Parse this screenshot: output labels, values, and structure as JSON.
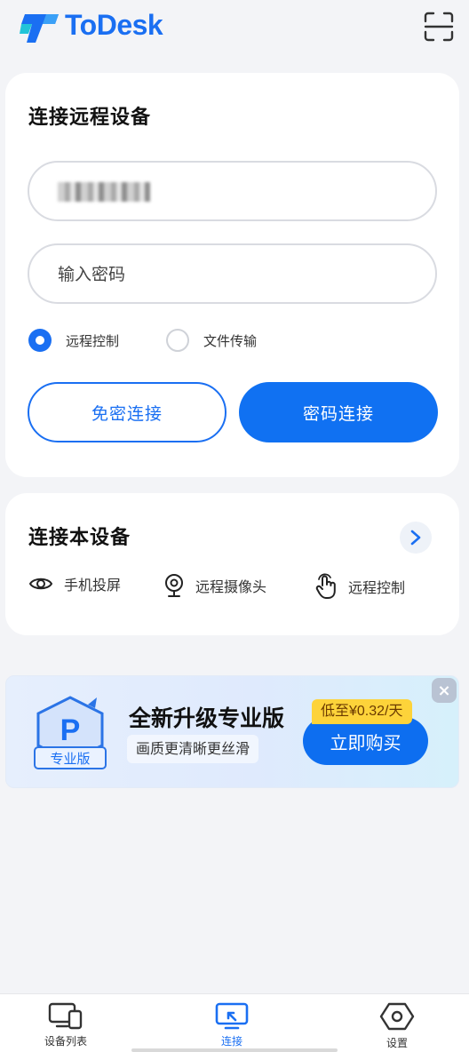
{
  "header": {
    "brand": "ToDesk",
    "brand_color": "#1a6ff2"
  },
  "remote": {
    "title": "连接远程设备",
    "device_id_masked": true,
    "password_placeholder": "输入密码",
    "modes": [
      {
        "label": "远程控制",
        "selected": true
      },
      {
        "label": "文件传输",
        "selected": false
      }
    ],
    "btn_no_password": "免密连接",
    "btn_password": "密码连接"
  },
  "local": {
    "title": "连接本设备",
    "features": [
      {
        "label": "手机投屏",
        "icon": "eye-icon"
      },
      {
        "label": "远程摄像头",
        "icon": "webcam-icon"
      },
      {
        "label": "远程控制",
        "icon": "touch-hand-icon"
      }
    ]
  },
  "promo": {
    "badge_label": "专业版",
    "title": "全新升级专业版",
    "subtitle": "画质更清晰更丝滑",
    "price_tag": "低至¥0.32/天",
    "buy_label": "立即购买"
  },
  "nav": {
    "items": [
      {
        "label": "设备列表",
        "icon": "devices-icon",
        "active": false
      },
      {
        "label": "连接",
        "icon": "connect-icon",
        "active": true
      },
      {
        "label": "设置",
        "icon": "settings-hex-icon",
        "active": false
      }
    ]
  },
  "colors": {
    "accent": "#1071f2",
    "price_yellow": "#fdd33a"
  }
}
